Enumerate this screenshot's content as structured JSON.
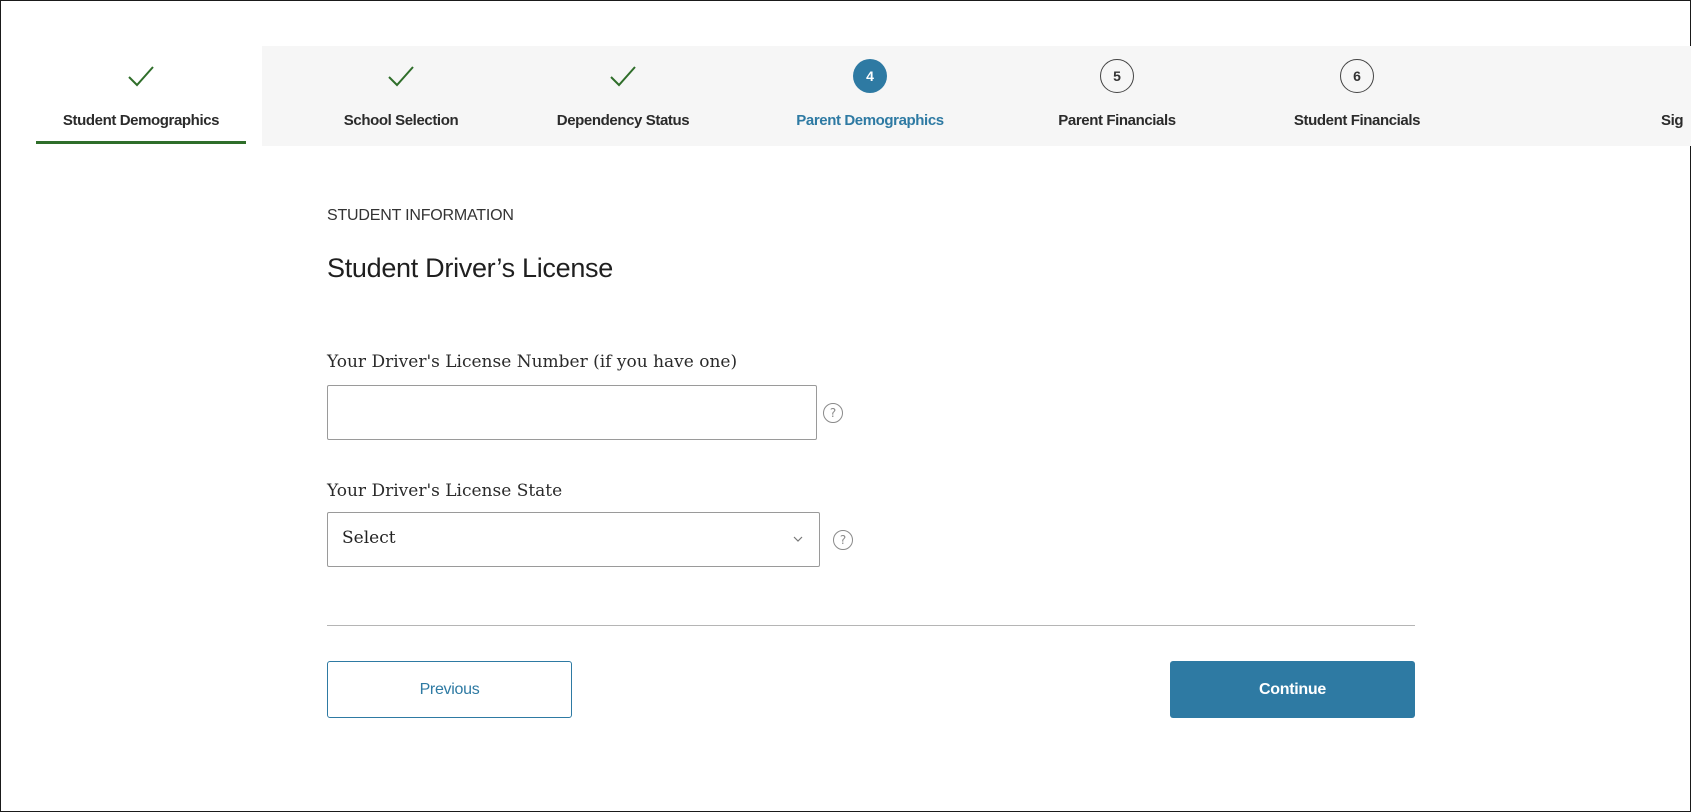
{
  "stepper": {
    "steps": [
      {
        "label": "Student Demographics",
        "status": "complete",
        "icon": "check-icon"
      },
      {
        "label": "School Selection",
        "status": "complete",
        "icon": "check-icon"
      },
      {
        "label": "Dependency Status",
        "status": "complete",
        "icon": "check-icon"
      },
      {
        "label": "Parent Demographics",
        "status": "current",
        "number": "4"
      },
      {
        "label": "Parent Financials",
        "status": "upcoming",
        "number": "5"
      },
      {
        "label": "Student Financials",
        "status": "upcoming",
        "number": "6"
      },
      {
        "label": "Sig",
        "status": "upcoming"
      }
    ],
    "colors": {
      "complete_check": "#2f6e2a",
      "current": "#2e7aa3",
      "active_underline": "#2f6e2a"
    }
  },
  "form": {
    "section_label": "STUDENT INFORMATION",
    "title": "Student Driver’s License",
    "license_number": {
      "label": "Your Driver's License Number (if you have one)",
      "value": "",
      "help_icon": "question-circle-icon",
      "help_glyph": "?"
    },
    "license_state": {
      "label": "Your Driver's License State",
      "selected": "Select",
      "help_icon": "question-circle-icon",
      "help_glyph": "?"
    }
  },
  "buttons": {
    "previous": "Previous",
    "continue": "Continue",
    "accent": "#2e7aa3"
  }
}
